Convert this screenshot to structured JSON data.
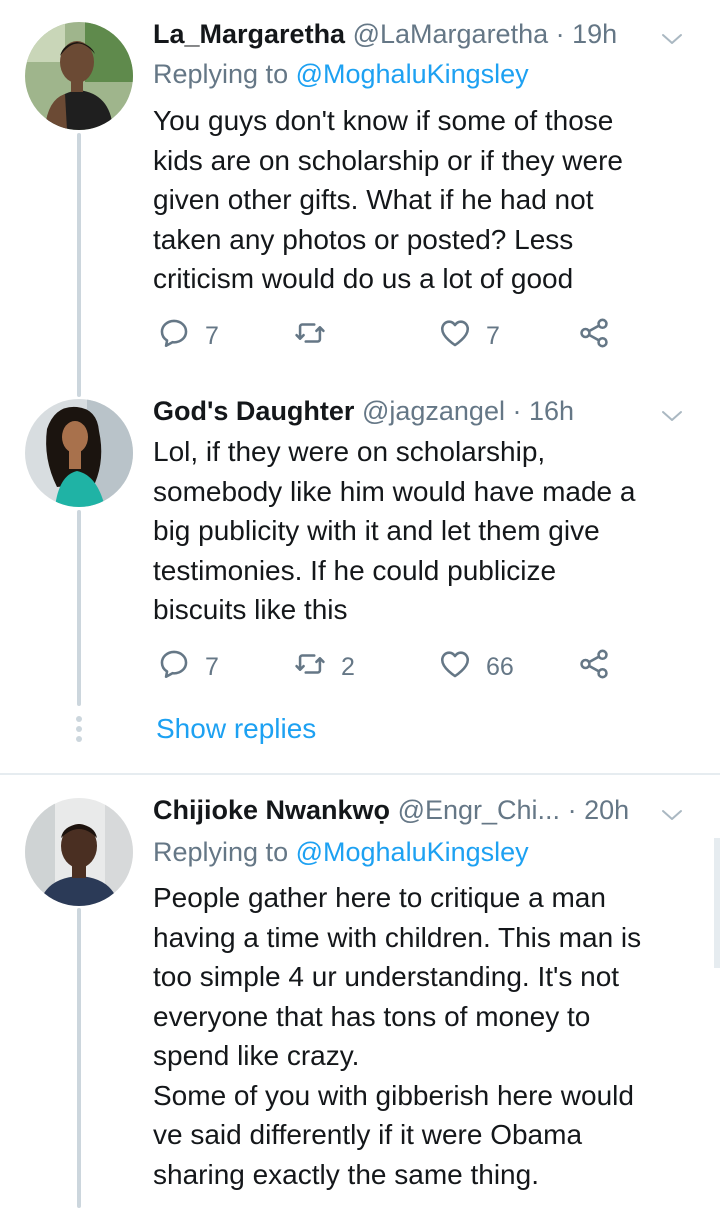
{
  "tweets": [
    {
      "name": "La_Margaretha",
      "handle": "@LaMargaretha",
      "separator": "·",
      "time": "19h",
      "replying_prefix": "Replying to",
      "replying_to": "@MoghaluKingsley",
      "lines": [
        "You guys don't know if some of those",
        "kids are on scholarship or if they were",
        "given other gifts. What if he had not",
        "taken any photos or posted? Less",
        "criticism would do us a lot of good"
      ],
      "reply_count": "7",
      "retweet_count": "",
      "like_count": "7"
    },
    {
      "name": "God's Daughter",
      "handle": "@jagzangel",
      "separator": "·",
      "time": "16h",
      "lines": [
        "Lol, if they were on scholarship,",
        "somebody like him would have made a",
        "big publicity with it and let them give",
        "testimonies. If he could publicize",
        "biscuits like this"
      ],
      "reply_count": "7",
      "retweet_count": "2",
      "like_count": "66"
    },
    {
      "name": "Chijioke Nwankwọ",
      "handle": "@Engr_Chi...",
      "separator": "·",
      "time": "20h",
      "replying_prefix": "Replying to",
      "replying_to": "@MoghaluKingsley",
      "lines": [
        "People gather here to critique a man",
        "having a time with children. This man is",
        "too simple 4 ur understanding. It's not",
        "everyone that has tons of money to",
        "spend like crazy.",
        "Some of you with gibberish here would",
        "ve said differently if it were Obama",
        "sharing exactly the same thing."
      ]
    }
  ],
  "show_replies_label": "Show replies",
  "colors": {
    "link": "#1da1f2",
    "secondary_text": "#657786",
    "thread_line": "#ccd6dd",
    "divider": "#e6ecf0"
  },
  "icons": [
    "reply-icon",
    "retweet-icon",
    "like-icon",
    "share-icon",
    "chevron-down-icon"
  ]
}
